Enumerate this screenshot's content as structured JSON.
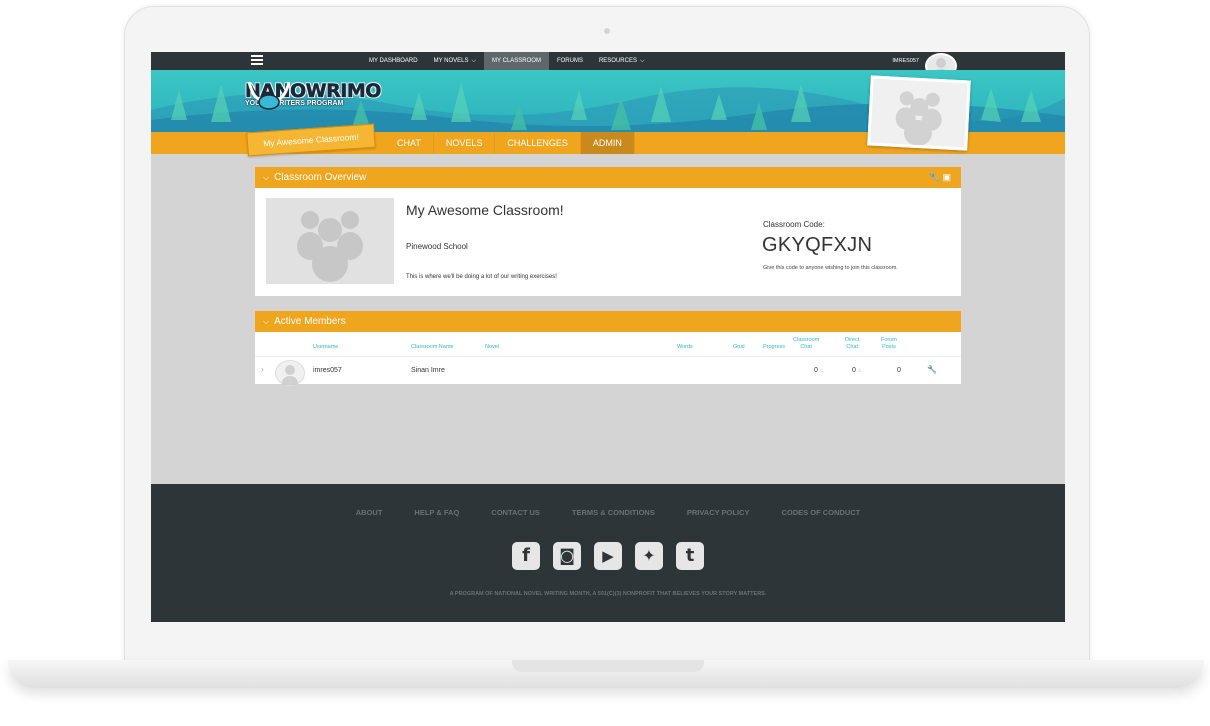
{
  "nav": {
    "items": [
      {
        "label": "MY DASHBOARD",
        "dropdown": false,
        "active": false
      },
      {
        "label": "MY NOVELS",
        "dropdown": true,
        "active": false
      },
      {
        "label": "MY CLASSROOM",
        "dropdown": false,
        "active": true
      },
      {
        "label": "FORUMS",
        "dropdown": false,
        "active": false
      },
      {
        "label": "RESOURCES",
        "dropdown": true,
        "active": false
      }
    ],
    "username": "IMRES057"
  },
  "logo": {
    "main": "NANOWRIMO",
    "sub": "YOUNG WRITERS PROGRAM"
  },
  "classroom": {
    "tag": "My Awesome Classroom!",
    "tabs": [
      {
        "label": "CHAT",
        "active": false
      },
      {
        "label": "NOVELS",
        "active": false
      },
      {
        "label": "CHALLENGES",
        "active": false
      },
      {
        "label": "ADMIN",
        "active": true
      }
    ]
  },
  "overview": {
    "header": "Classroom Overview",
    "title": "My Awesome Classroom!",
    "school": "Pinewood School",
    "description": "This is where we'll be doing a lot of our writing exercises!",
    "code_label": "Classroom Code:",
    "code": "GKYQFXJN",
    "code_help": "Give this code to anyone wishing to join this classroom."
  },
  "members": {
    "header": "Active Members",
    "columns": {
      "username": "Username",
      "classroom_name": "Classroom Name",
      "novel": "Novel",
      "words": "Words",
      "goal": "Goal",
      "progress": "Progress",
      "classroom_chat_1": "Classroom",
      "classroom_chat_2": "Chat",
      "direct_chat_1": "Direct",
      "direct_chat_2": "Chat",
      "forum_posts_1": "Forum",
      "forum_posts_2": "Posts"
    },
    "rows": [
      {
        "username": "imres057",
        "classroom_name": "Sinan Imre",
        "classroom_chat": "0",
        "direct_chat": "0",
        "forum_posts": "0"
      }
    ]
  },
  "footer": {
    "links": [
      "ABOUT",
      "HELP & FAQ",
      "CONTACT US",
      "TERMS & CONDITIONS",
      "PRIVACY POLICY",
      "CODES OF CONDUCT"
    ],
    "social": [
      "facebook-icon",
      "instagram-icon",
      "youtube-icon",
      "twitter-icon",
      "tumblr-icon"
    ],
    "tagline": "A PROGRAM OF NATIONAL NOVEL WRITING MONTH, A 501(C)(3) NONPROFIT THAT BELIEVES YOUR STORY MATTERS."
  },
  "colors": {
    "orange": "#f0a51f",
    "teal": "#31b8c3",
    "dark": "#2e3538"
  }
}
